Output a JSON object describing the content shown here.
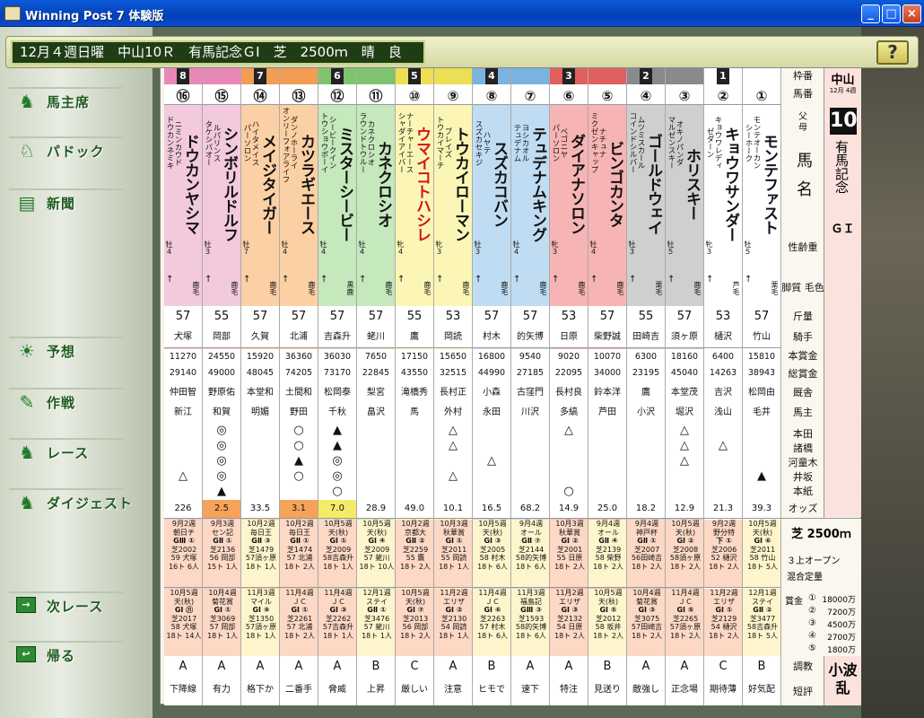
{
  "window": {
    "title": "Winning Post 7 体験版",
    "controls": [
      "_",
      "□",
      "×"
    ]
  },
  "race_info": "12月４週日曜　中山10Ｒ　有馬記念ＧⅠ　芝　2500ｍ　晴　良",
  "help_label": "?",
  "nav": [
    {
      "label": "馬主席",
      "icon": "horse-owner-icon"
    },
    {
      "label": "パドック",
      "icon": "paddock-horse-icon"
    },
    {
      "label": "新聞",
      "icon": "newspaper-icon"
    },
    {
      "label": "予想",
      "icon": "lightbulb-icon"
    },
    {
      "label": "作戦",
      "icon": "strategy-icon"
    },
    {
      "label": "レース",
      "icon": "race-horse-icon"
    },
    {
      "label": "ダイジェスト",
      "icon": "digest-horse-icon"
    },
    {
      "label": "次レース",
      "icon": "arrow-next-icon"
    },
    {
      "label": "帰る",
      "icon": "arrow-return-icon"
    }
  ],
  "row_labels": [
    "枠番",
    "馬番",
    "父",
    "母",
    "馬名",
    "性齢重",
    "脚質 毛色",
    "斤量",
    "騎手",
    "本賞金",
    "総賞金",
    "厩舎",
    "馬主",
    "本田",
    "諸橋",
    "河童木",
    "井坂",
    "本紙",
    "オッズ",
    "調教",
    "短評"
  ],
  "race_panel": {
    "venue": "中山",
    "date": "12月 4週",
    "race_no": "10",
    "race_name": "有馬記念",
    "grade": "ＧＩ"
  },
  "race_summary": {
    "surface_distance": "芝 2500ｍ",
    "class": "３上オープン",
    "weight": "混合定量",
    "prize_label": "賞金",
    "prizes": [
      {
        "rank": "①",
        "amount": "18000万"
      },
      {
        "rank": "②",
        "amount": "7200万"
      },
      {
        "rank": "③",
        "amount": "4500万"
      },
      {
        "rank": "④",
        "amount": "2700万"
      },
      {
        "rank": "⑤",
        "amount": "1800万"
      }
    ],
    "writer": "小波乱"
  },
  "horses": [
    {
      "waku": "8",
      "no": "⑯",
      "sire": "ドウカンネミキ",
      "dam": "ニミンカウド",
      "name": "ドウカンヤシマ",
      "sex": "牡４",
      "style": "↑",
      "coat": "鹿毛",
      "kin": "57",
      "jockey": "犬塚",
      "prize1": "11270",
      "prize2": "29140",
      "stable": "仲田智",
      "owner": "新江",
      "marks": [
        "",
        "",
        "",
        "△",
        ""
      ],
      "odds": "226",
      "last1": [
        "9月2週",
        "朝日チ",
        "GⅢ ①",
        "芝2002",
        "59 犬塚",
        "16ト 6人"
      ],
      "last2": [
        "10月5週",
        "天(秋)",
        "GⅠ ⑪",
        "芝2017",
        "58 犬塚",
        "18ト 14人"
      ],
      "train": "A",
      "comment": "下降線",
      "color": "#f2c9dd",
      "pcol": "#fcd8c5"
    },
    {
      "waku": "8",
      "no": "⑮",
      "sire": "タケシバオー",
      "dam": "ルパリンス",
      "name": "シンボリルドルフ",
      "sex": "牡３",
      "style": "↑",
      "coat": "鹿毛",
      "kin": "55",
      "jockey": "岡部",
      "prize1": "24550",
      "prize2": "49000",
      "stable": "野原佑",
      "owner": "和賀",
      "marks": [
        "◎",
        "◎",
        "◎",
        "◎",
        "▲"
      ],
      "odds": "2.5",
      "last1": [
        "9月3週",
        "セン記",
        "GⅡ ①",
        "芝2136",
        "56 岡部",
        "15ト 1人"
      ],
      "last2": [
        "10月4週",
        "菊花賞",
        "GⅠ ①",
        "芝3069",
        "57 岡部",
        "18ト 1人"
      ],
      "train": "A",
      "comment": "有力",
      "color": "#f2c9dd",
      "pcol": "#fcd8c5"
    },
    {
      "waku": "7",
      "no": "⑭",
      "sire": "パーソロン",
      "dam": "ハイタメイス",
      "name": "メイジタイガー",
      "sex": "牡７",
      "style": "↑",
      "coat": "鹿毛",
      "kin": "57",
      "jockey": "久賀",
      "prize1": "15920",
      "prize2": "48045",
      "stable": "本堂和",
      "owner": "明媚",
      "marks": [
        "",
        "",
        "",
        "",
        ""
      ],
      "odds": "33.5",
      "last1": [
        "10月2週",
        "毎日王",
        "GⅡ ③",
        "芝1479",
        "57須ヶ原",
        "18ト 1人"
      ],
      "last2": [
        "11月3週",
        "マイル",
        "GⅠ ⑨",
        "芝1350",
        "57須ヶ原",
        "18ト 1人"
      ],
      "train": "A",
      "comment": "格下か",
      "color": "#fbd0a4",
      "pcol": "#fff5cc"
    },
    {
      "waku": "7",
      "no": "⑬",
      "sire": "オンリーフォアライフ",
      "dam": "ダンノホーライ",
      "name": "カツラギエース",
      "sex": "牡４",
      "style": "↑",
      "coat": "鹿毛",
      "kin": "57",
      "jockey": "北浦",
      "prize1": "36360",
      "prize2": "74205",
      "stable": "土間和",
      "owner": "野田",
      "marks": [
        "○",
        "○",
        "▲",
        "○",
        ""
      ],
      "odds": "3.1",
      "last1": [
        "10月2週",
        "毎日王",
        "GⅡ ①",
        "芝1474",
        "57 北浦",
        "18ト 2人"
      ],
      "last2": [
        "11月4週",
        "ＪＣ",
        "GⅠ ①",
        "芝2261",
        "57 北浦",
        "18ト 2人"
      ],
      "train": "A",
      "comment": "二番手",
      "color": "#fbd0a4",
      "pcol": "#fcd8c5"
    },
    {
      "waku": "6",
      "no": "⑫",
      "sire": "トウショウボーイ",
      "dam": "シービークイン",
      "name": "ミスターシービー",
      "sex": "牡４",
      "style": "↑",
      "coat": "黒鹿",
      "kin": "57",
      "jockey": "吉森升",
      "prize1": "36030",
      "prize2": "73170",
      "stable": "松岡泰",
      "owner": "千秋",
      "marks": [
        "▲",
        "▲",
        "◎",
        "◎",
        "○"
      ],
      "odds": "7.0",
      "last1": [
        "10月5週",
        "天(秋)",
        "GⅠ ①",
        "芝2009",
        "58吉森升",
        "18ト 1人"
      ],
      "last2": [
        "11月4週",
        "ＪＣ",
        "GⅠ ③",
        "芝2262",
        "57吉森升",
        "18ト 1人"
      ],
      "train": "A",
      "comment": "脅威",
      "color": "#c5e8bd",
      "pcol": "#fcd8c5"
    },
    {
      "waku": "6",
      "no": "⑪",
      "sire": "ラウンドトウルー",
      "dam": "カネクロシオ",
      "name": "カネクロシオ",
      "sex": "牡４",
      "style": "↑",
      "coat": "鹿毛",
      "kin": "57",
      "jockey": "蛯川",
      "prize1": "7650",
      "prize2": "22845",
      "stable": "梨宮",
      "owner": "畠沢",
      "marks": [
        "",
        "",
        "",
        "",
        ""
      ],
      "odds": "28.9",
      "last1": [
        "10月5週",
        "天(秋)",
        "GⅠ ④",
        "芝2009",
        "57 蛯川",
        "18ト 10人"
      ],
      "last2": [
        "12月1週",
        "ステイ",
        "GⅡ ①",
        "芝3476",
        "57 蛯川",
        "18ト 1人"
      ],
      "train": "B",
      "comment": "上昇",
      "color": "#c5e8bd",
      "pcol": "#fff5cc"
    },
    {
      "waku": "5",
      "no": "⑩",
      "sire": "シャダイアイバー",
      "dam": "ナーチャーエース",
      "name": "ウマイコトハシレ",
      "sex": "牝４",
      "style": "↑",
      "coat": "鹿毛",
      "kin": "55",
      "jockey": "鷹",
      "prize1": "17150",
      "prize2": "43550",
      "stable": "滝橋秀",
      "owner": "馬",
      "marks": [
        "",
        "",
        "",
        "",
        ""
      ],
      "odds": "49.0",
      "last1": [
        "10月2週",
        "京都大",
        "GⅡ ②",
        "芝2259",
        "55 鷹",
        "18ト 2人"
      ],
      "last2": [
        "10月5週",
        "天(秋)",
        "GⅠ ⑦",
        "芝2013",
        "56 岡部",
        "18ト 2人"
      ],
      "train": "C",
      "comment": "厳しい",
      "color": "#fbf6b5",
      "pcol": "#fcd8c5"
    },
    {
      "waku": "5",
      "no": "⑨",
      "sire": "トウカイマーチ",
      "dam": "ブレイズ",
      "name": "トウカイローマン",
      "sex": "牝３",
      "style": "↑",
      "coat": "鹿毛",
      "kin": "53",
      "jockey": "岡読",
      "prize1": "15650",
      "prize2": "32515",
      "stable": "長村正",
      "owner": "外村",
      "marks": [
        "△",
        "△",
        "",
        "△",
        ""
      ],
      "odds": "10.1",
      "last1": [
        "10月3週",
        "秋華賞",
        "GⅠ ①",
        "芝2011",
        "55 岡読",
        "18ト 1人"
      ],
      "last2": [
        "11月2週",
        "エリザ",
        "GⅠ ②",
        "芝2130",
        "54 岡読",
        "18ト 1人"
      ],
      "train": "A",
      "comment": "注意",
      "color": "#fbf6b5",
      "pcol": "#fcd8c5"
    },
    {
      "waku": "4",
      "no": "⑧",
      "sire": "スズカセキジ",
      "dam": "ハヤテ",
      "name": "スズカコバン",
      "sex": "牡３",
      "style": "↑",
      "coat": "鹿毛",
      "kin": "57",
      "jockey": "村木",
      "prize1": "16800",
      "prize2": "44990",
      "stable": "小森",
      "owner": "永田",
      "marks": [
        "",
        "",
        "△",
        "",
        ""
      ],
      "odds": "16.5",
      "last1": [
        "10月5週",
        "天(秋)",
        "GⅠ ③",
        "芝2005",
        "58 村木",
        "18ト 6人"
      ],
      "last2": [
        "11月4週",
        "ＪＣ",
        "GⅠ ⑥",
        "芝2263",
        "57 村木",
        "18ト 6人"
      ],
      "train": "B",
      "comment": "ヒモで",
      "color": "#c0dcf2",
      "pcol": "#fff5cc"
    },
    {
      "waku": "4",
      "no": "⑦",
      "sire": "テュデナム",
      "dam": "ヨシカオル",
      "name": "テュデナムキング",
      "sex": "牡４",
      "style": "↑",
      "coat": "鹿毛",
      "kin": "57",
      "jockey": "的矢博",
      "prize1": "9540",
      "prize2": "27185",
      "stable": "古窪門",
      "owner": "川沢",
      "marks": [
        "",
        "",
        "",
        "",
        ""
      ],
      "odds": "68.2",
      "last1": [
        "9月4週",
        "オール",
        "GⅡ ⑦",
        "芝2144",
        "58的矢博",
        "18ト 6人"
      ],
      "last2": [
        "11月3週",
        "福島記",
        "GⅢ ③",
        "芝1593",
        "58的矢博",
        "18ト 6人"
      ],
      "train": "A",
      "comment": "速下",
      "color": "#c0dcf2",
      "pcol": "#fff5cc"
    },
    {
      "waku": "3",
      "no": "⑥",
      "sire": "パーソロン",
      "dam": "ベゴニヤ",
      "name": "ダイアナソロン",
      "sex": "牝３",
      "style": "↑",
      "coat": "鹿毛",
      "kin": "53",
      "jockey": "日原",
      "prize1": "9020",
      "prize2": "22095",
      "stable": "長村良",
      "owner": "多縞",
      "marks": [
        "△",
        "",
        "",
        "",
        "○"
      ],
      "odds": "14.9",
      "last1": [
        "10月3週",
        "秋華賞",
        "GⅠ ②",
        "芝2001",
        "55 日原",
        "18ト 2人"
      ],
      "last2": [
        "11月2週",
        "エリザ",
        "GⅠ ③",
        "芝2132",
        "54 日原",
        "18ト 2人"
      ],
      "train": "A",
      "comment": "特注",
      "color": "#f7b4b4",
      "pcol": "#fcd8c5"
    },
    {
      "waku": "3",
      "no": "⑤",
      "sire": "ミクゼンキャップ",
      "dam": "ナチュナ",
      "name": "ビンゴカンタ",
      "sex": "牡４",
      "style": "↑",
      "coat": "鹿毛",
      "kin": "57",
      "jockey": "柴野誠",
      "prize1": "10070",
      "prize2": "34000",
      "stable": "鈴本洋",
      "owner": "芦田",
      "marks": [
        "",
        "",
        "",
        "",
        ""
      ],
      "odds": "25.0",
      "last1": [
        "9月4週",
        "オール",
        "GⅡ ④",
        "芝2139",
        "58 柴野",
        "18ト 2人"
      ],
      "last2": [
        "10月5週",
        "天(秋)",
        "GⅠ ⑤",
        "芝2012",
        "58 坂井",
        "18ト 2人"
      ],
      "train": "B",
      "comment": "見送り",
      "color": "#f7b4b4",
      "pcol": "#fff5cc"
    },
    {
      "waku": "2",
      "no": "④",
      "sire": "コインドシルバー",
      "dam": "ムツミスカール",
      "name": "ゴールドウェイ",
      "sex": "牡３",
      "style": "↑",
      "coat": "栗毛",
      "kin": "55",
      "jockey": "田崎吉",
      "prize1": "6300",
      "prize2": "23195",
      "stable": "鷹",
      "owner": "小沢",
      "marks": [
        "",
        "",
        "",
        "",
        ""
      ],
      "odds": "18.2",
      "last1": [
        "9月4週",
        "神戸杯",
        "GⅡ ①",
        "芝2007",
        "56田崎吉",
        "18ト 2人"
      ],
      "last2": [
        "10月4週",
        "菊花賞",
        "GⅠ ③",
        "芝3075",
        "57田崎吉",
        "18ト 2人"
      ],
      "train": "A",
      "comment": "敵強し",
      "color": "#cfcfcf",
      "pcol": "#fcd8c5"
    },
    {
      "waku": "2",
      "no": "③",
      "sire": "マルゼンスキー",
      "dam": "オキノパンダ",
      "name": "ホリスキー",
      "sex": "牡５",
      "style": "↑",
      "coat": "鹿毛",
      "kin": "57",
      "jockey": "須ヶ原",
      "prize1": "18160",
      "prize2": "45040",
      "stable": "本堂茂",
      "owner": "堀沢",
      "marks": [
        "△",
        "△",
        "△",
        "",
        ""
      ],
      "odds": "12.9",
      "last1": [
        "10月5週",
        "天(秋)",
        "GⅠ ②",
        "芝2008",
        "58須ヶ原",
        "18ト 2人"
      ],
      "last2": [
        "11月4週",
        "ＪＣ",
        "GⅠ ⑤",
        "芝2265",
        "57須ヶ原",
        "18ト 2人"
      ],
      "train": "A",
      "comment": "正念場",
      "color": "#cfcfcf",
      "pcol": "#fcd8c5"
    },
    {
      "waku": "1",
      "no": "②",
      "sire": "ゼダーン",
      "dam": "キョウワレディ",
      "name": "キョウワサンダー",
      "sex": "牝３",
      "style": "↑",
      "coat": "芦毛",
      "kin": "53",
      "jockey": "樋沢",
      "prize1": "6400",
      "prize2": "14263",
      "stable": "吉沢",
      "owner": "浅山",
      "marks": [
        "",
        "△",
        "",
        "",
        ""
      ],
      "odds": "21.3",
      "last1": [
        "9月2週",
        "野分特",
        "下 ①",
        "芝2006",
        "52 樋沢",
        "18ト 2人"
      ],
      "last2": [
        "11月2週",
        "エリザ",
        "GⅠ ①",
        "芝2129",
        "54 樋沢",
        "18ト 2人"
      ],
      "train": "C",
      "comment": "期待薄",
      "color": "#ffffff",
      "pcol": "#fcd8c5"
    },
    {
      "waku": "1",
      "no": "①",
      "sire": "シーホーク",
      "dam": "モンテオーカン",
      "name": "モンテファスト",
      "sex": "牡５",
      "style": "↑",
      "coat": "栗毛",
      "kin": "57",
      "jockey": "竹山",
      "prize1": "15810",
      "prize2": "38943",
      "stable": "松岡由",
      "owner": "毛井",
      "marks": [
        "",
        "",
        "",
        "▲",
        ""
      ],
      "odds": "39.3",
      "last1": [
        "10月5週",
        "天(秋)",
        "GⅠ ⑥",
        "芝2011",
        "58 竹山",
        "18ト 5人"
      ],
      "last2": [
        "12月1週",
        "ステイ",
        "GⅡ ②",
        "芝3477",
        "58吉森升",
        "18ト 5人"
      ],
      "train": "B",
      "comment": "好気配",
      "color": "#ffffff",
      "pcol": "#fff5cc"
    }
  ],
  "waku_colors": {
    "8": "#e888b8",
    "7": "#f39c54",
    "6": "#7ec46e",
    "5": "#ecde55",
    "4": "#7bb3e0",
    "3": "#e06060",
    "2": "#8a8a8a",
    "1": "#ffffff"
  }
}
